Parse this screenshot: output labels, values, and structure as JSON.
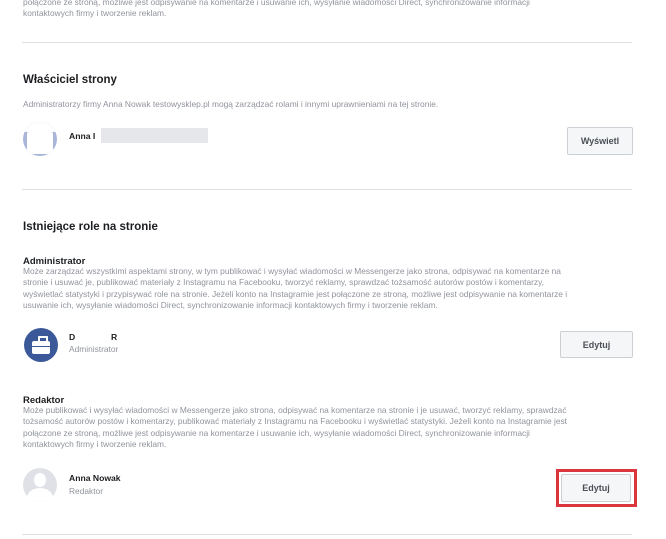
{
  "top": {
    "text_line1": "połączone ze stroną, możliwe jest odpisywanie na komentarze i usuwanie ich, wysyłanie wiadomości Direct, synchronizowanie informacji",
    "text_line2": "kontaktowych firmy i tworzenie reklam."
  },
  "owner": {
    "title": "Właściciel strony",
    "description": "Administratorzy firmy Anna Nowak testowysklep.pl mogą zarządzać rolami i innymi uprawnieniami na tej stronie.",
    "name": "Anna I",
    "button": "Wyświetl"
  },
  "roles": {
    "title": "Istniejące role na stronie",
    "admin": {
      "heading": "Administrator",
      "desc": [
        "Może zarządzać wszystkimi aspektami strony, w tym publikować i wysyłać wiadomości w Messengerze jako strona, odpisywać na komentarze na",
        "stronie i usuwać je, publikować materiały z Instagramu na Facebooku, tworzyć reklamy, sprawdzać tożsamość autorów postów i komentarzy,",
        "wyświetlać statystyki i przypisywać role na stronie. Jeżeli konto na Instagramie jest połączone ze stroną, możliwe jest odpisywanie na komentarze i",
        "usuwanie ich, wysyłanie wiadomości Direct, synchronizowanie informacji kontaktowych firmy i tworzenie reklam."
      ],
      "user_initial_first": "D",
      "user_initial_last": "R",
      "user_role": "Administrator",
      "button": "Edytuj"
    },
    "editor": {
      "heading": "Redaktor",
      "desc": [
        "Może publikować i wysyłać wiadomości w Messengerze jako strona, odpisywać na komentarze na stronie i je usuwać, tworzyć reklamy, sprawdzać",
        "tożsamość autorów postów i komentarzy, publikować materiały z Instagramu na Facebooku i wyświetlać statystyki. Jeżeli konto na Instagramie jest",
        "połączone ze stroną, możliwe jest odpisywanie na komentarze i usuwanie ich, wysyłanie wiadomości Direct, synchronizowanie informacji",
        "kontaktowych firmy i tworzenie reklam."
      ],
      "user_name": "Anna Nowak",
      "user_role": "Redaktor",
      "button": "Edytuj"
    }
  },
  "colors": {
    "highlight": "#d9363e",
    "admin_avatar_bg": "#3b5998",
    "owner_avatar_bg": "#a9b6da"
  }
}
